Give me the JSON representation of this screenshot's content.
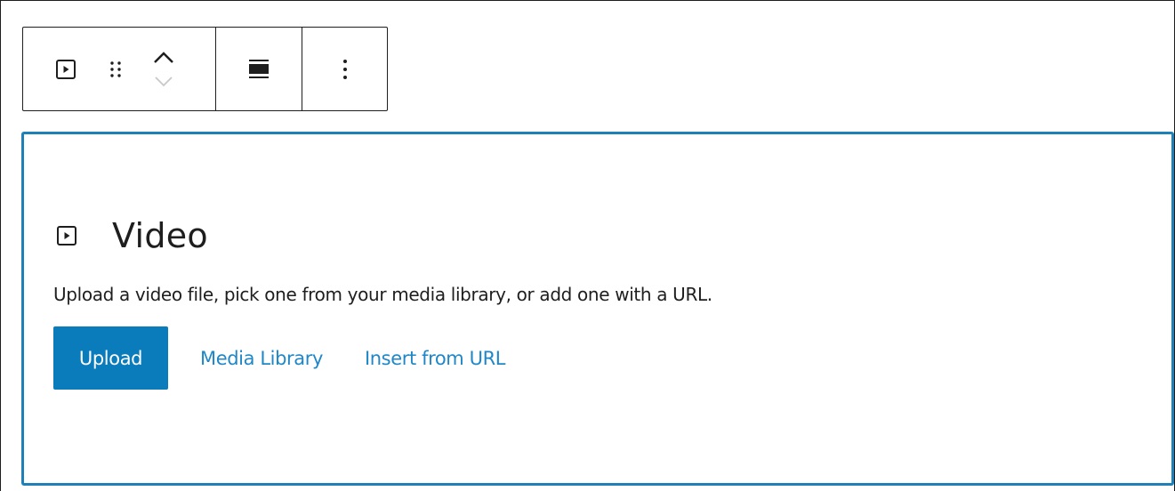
{
  "toolbar": {
    "block_type_icon": "video-icon",
    "drag_icon": "drag-handle-icon",
    "move_up_icon": "chevron-up-icon",
    "move_down_icon": "chevron-down-icon",
    "align_icon": "align-wide-icon",
    "options_icon": "more-vertical-icon"
  },
  "placeholder": {
    "icon": "video-icon",
    "title": "Video",
    "instructions": "Upload a video file, pick one from your media library, or add one with a URL.",
    "upload_label": "Upload",
    "media_library_label": "Media Library",
    "insert_url_label": "Insert from URL"
  },
  "colors": {
    "accent": "#1f80b8",
    "primary_button": "#0a7bbb",
    "link": "#1f87c7",
    "text": "#1e1e1e",
    "disabled": "#c8c8c8"
  }
}
